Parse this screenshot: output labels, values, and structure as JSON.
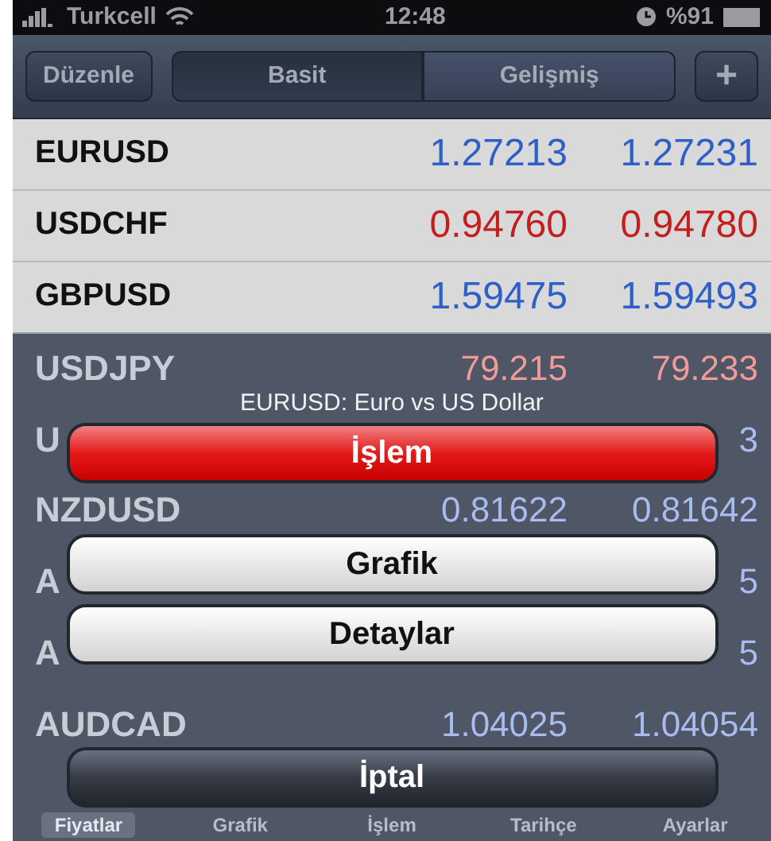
{
  "status_bar": {
    "carrier": "Turkcell",
    "time": "12:48",
    "battery": "%91"
  },
  "nav_bar": {
    "edit_button": "Düzenle",
    "segments": [
      {
        "label": "Basit",
        "selected": true
      },
      {
        "label": "Gelişmiş",
        "selected": false
      }
    ],
    "add_button": "+"
  },
  "quotes": [
    {
      "symbol": "EURUSD",
      "bid": "1.27213",
      "ask": "1.27231",
      "color": "#2c5fc8",
      "dimmed": false
    },
    {
      "symbol": "USDCHF",
      "bid": "0.94760",
      "ask": "0.94780",
      "color": "#c41f1f",
      "dimmed": false
    },
    {
      "symbol": "GBPUSD",
      "bid": "1.59475",
      "ask": "1.59493",
      "color": "#2c5fc8",
      "dimmed": false
    },
    {
      "symbol": "USDJPY",
      "bid": "79.215",
      "ask": "79.233",
      "color": "#f09a9a",
      "dimmed": true
    },
    {
      "symbol": "U",
      "ask": "3",
      "color": "#a8bcf0",
      "dimmed": true
    },
    {
      "symbol": "NZDUSD",
      "bid": "0.81622",
      "ask": "0.81642",
      "color": "#a8bcf0",
      "dimmed": true
    },
    {
      "symbol": "A",
      "ask": "5",
      "color": "#a8bcf0",
      "dimmed": true
    },
    {
      "symbol": "A",
      "ask": "5",
      "color": "#a8bcf0",
      "dimmed": true
    },
    {
      "symbol": "AUDCAD",
      "bid": "1.04025",
      "ask": "1.04054",
      "color": "#a8bcf0",
      "dimmed": true
    }
  ],
  "tab_bar": [
    {
      "label": "Fiyatlar",
      "selected": true
    },
    {
      "label": "Grafik",
      "selected": false
    },
    {
      "label": "İşlem",
      "selected": false
    },
    {
      "label": "Tarihçe",
      "selected": false
    },
    {
      "label": "Ayarlar",
      "selected": false
    }
  ],
  "action_sheet": {
    "title": "EURUSD: Euro vs US Dollar",
    "buttons": [
      {
        "label": "İşlem",
        "kind": "destructive"
      },
      {
        "label": "Grafik",
        "kind": "default"
      },
      {
        "label": "Detaylar",
        "kind": "default"
      },
      {
        "label": "İptal",
        "kind": "cancel"
      }
    ]
  }
}
